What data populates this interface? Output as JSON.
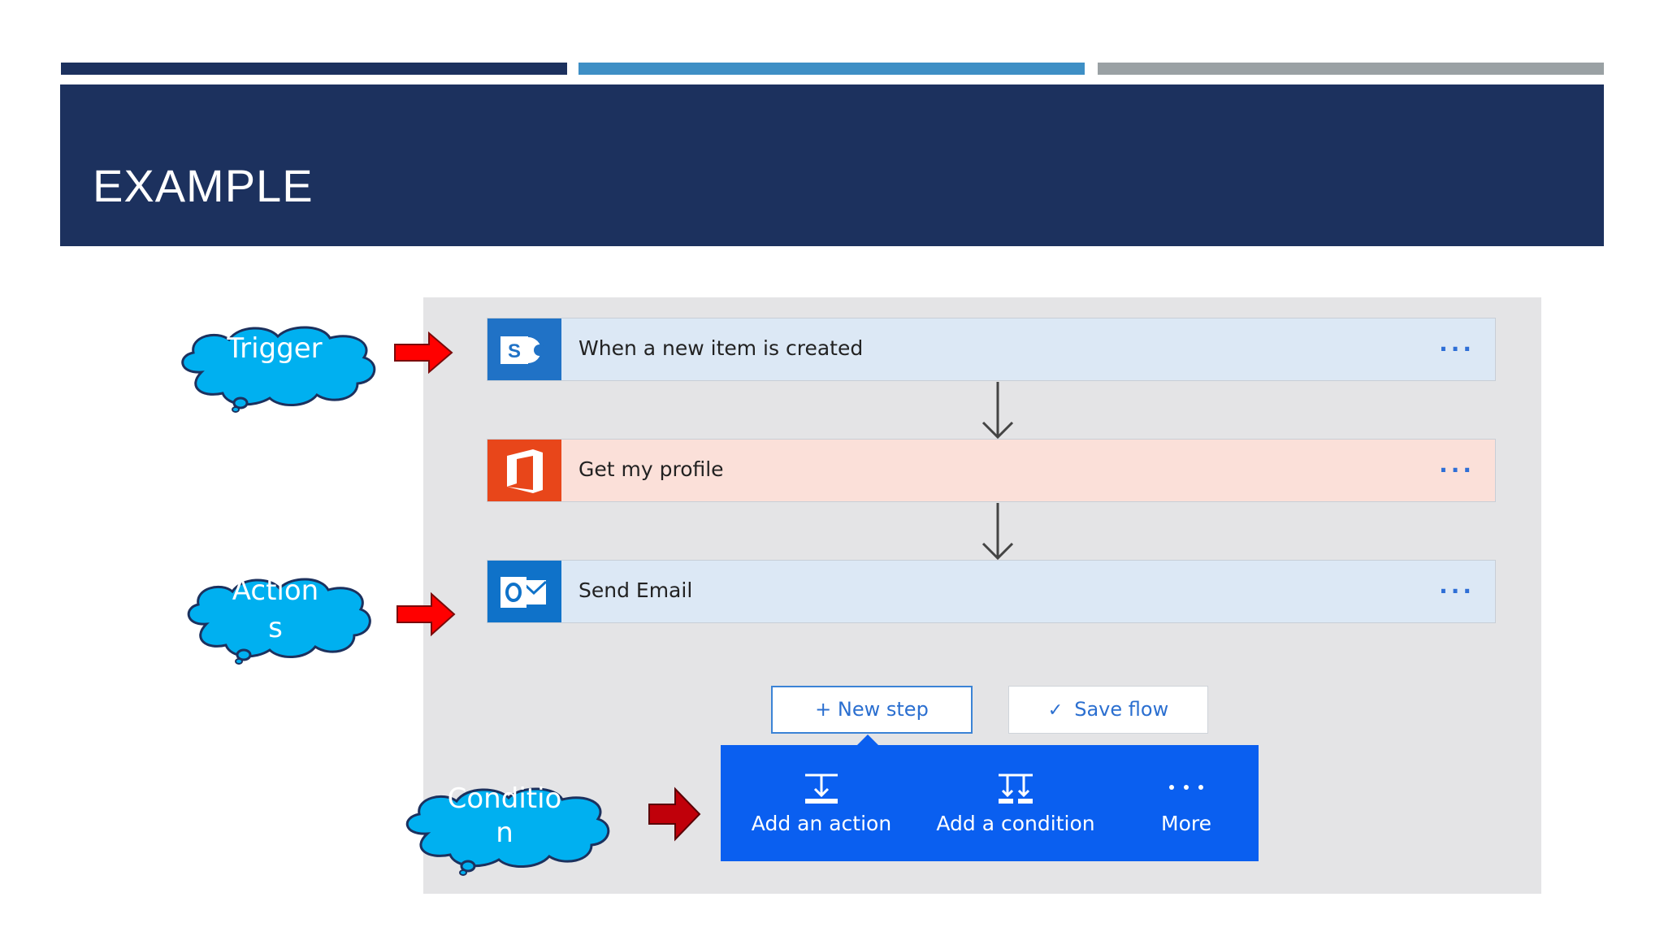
{
  "slide": {
    "title": "EXAMPLE",
    "accent_colors": [
      "#1c315e",
      "#3e8fc5",
      "#9aa1a4"
    ]
  },
  "flow": {
    "steps": [
      {
        "label": "When a new item is created",
        "icon": "sharepoint-icon",
        "more": "..."
      },
      {
        "label": "Get my profile",
        "icon": "office-icon",
        "more": "..."
      },
      {
        "label": "Send Email",
        "icon": "outlook-icon",
        "more": "..."
      }
    ],
    "new_step_label": "+ New step",
    "save_flow_label": "Save flow",
    "save_icon": "checkmark-icon",
    "menu": {
      "items": [
        {
          "label": "Add an action",
          "icon": "add-action-icon"
        },
        {
          "label": "Add a condition",
          "icon": "add-condition-icon"
        },
        {
          "label": "More",
          "icon": "ellipsis-icon"
        }
      ]
    }
  },
  "callouts": {
    "trigger": "Trigger",
    "actions_line1": "Action",
    "actions_line2": "s",
    "condition_line1": "Conditio",
    "condition_line2": "n"
  }
}
